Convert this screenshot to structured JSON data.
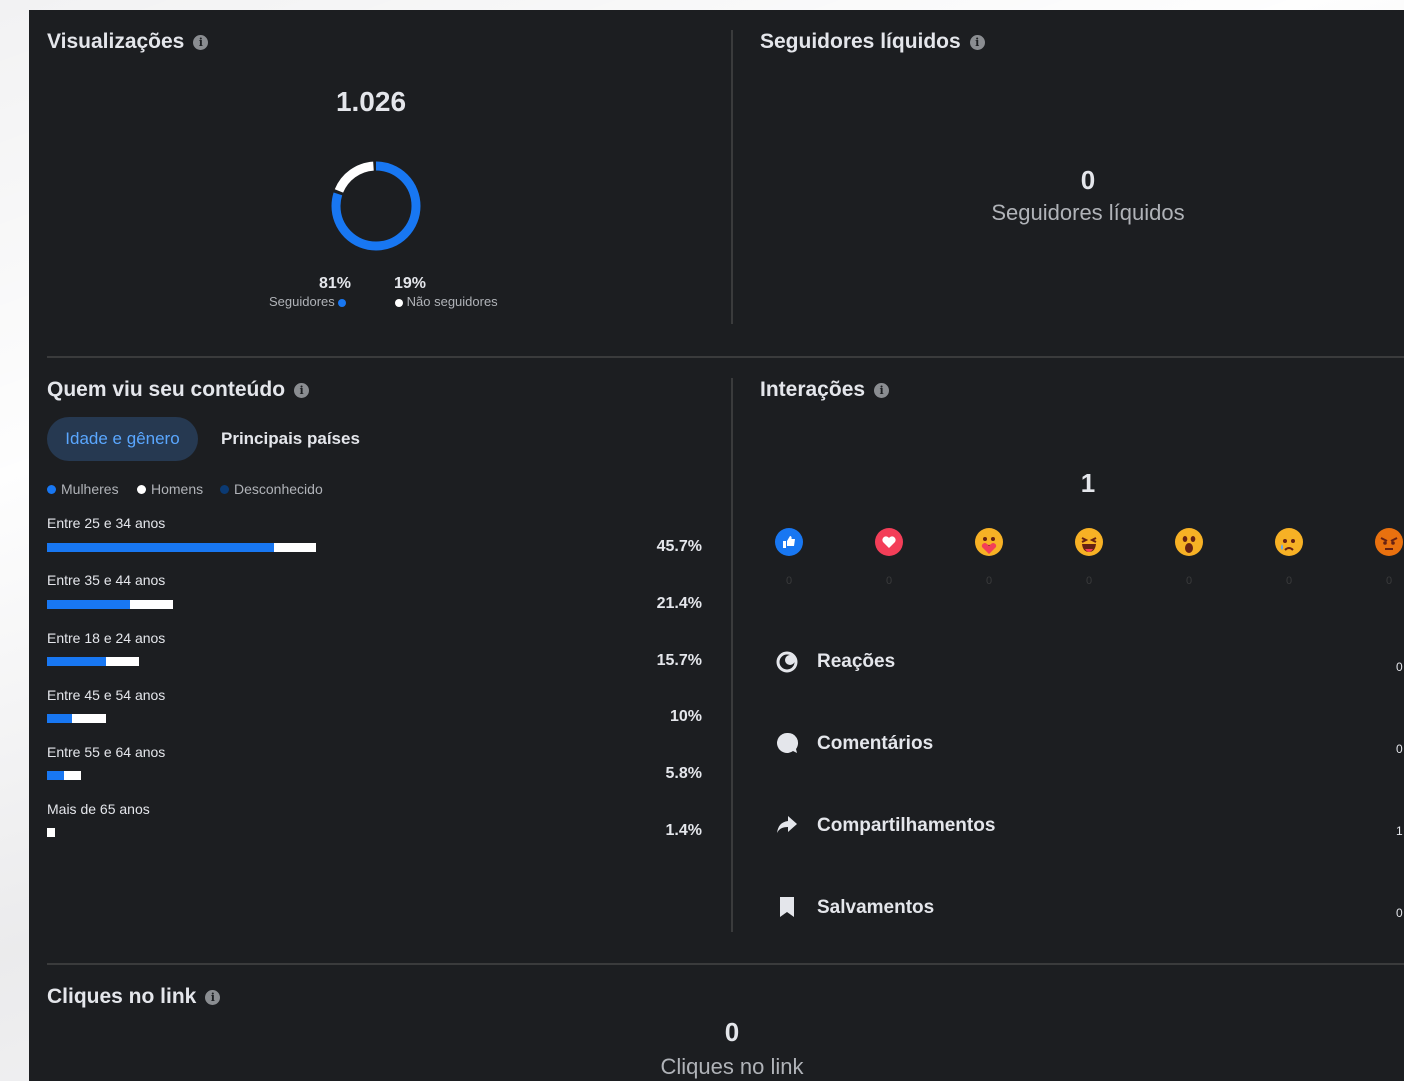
{
  "views": {
    "title": "Visualizações",
    "total": "1.026",
    "followers_pct": "81%",
    "followers_label": "Seguidores",
    "nonfollowers_pct": "19%",
    "nonfollowers_label": "Não seguidores",
    "followers_fraction": 0.81,
    "followers_color": "#1877f2",
    "nonfollowers_color": "#ffffff"
  },
  "net_followers": {
    "title": "Seguidores líquidos",
    "value": "0",
    "label": "Seguidores líquidos"
  },
  "audience": {
    "title": "Quem viu seu conteúdo",
    "tabs": [
      "Idade e gênero",
      "Principais países"
    ],
    "active_tab": "Idade e gênero",
    "legend": [
      {
        "label": "Mulheres",
        "color": "#1877f2"
      },
      {
        "label": "Homens",
        "color": "#ffffff"
      },
      {
        "label": "Desconhecido",
        "color": "#0b3a73"
      }
    ],
    "age_groups": [
      {
        "label": "Entre 25 e 34 anos",
        "pct": "45.7%",
        "total": 45.7,
        "women_share": 0.845
      },
      {
        "label": "Entre 35 e 44 anos",
        "pct": "21.4%",
        "total": 21.4,
        "women_share": 0.66
      },
      {
        "label": "Entre 18 e 24 anos",
        "pct": "15.7%",
        "total": 15.7,
        "women_share": 0.64
      },
      {
        "label": "Entre 45 e 54 anos",
        "pct": "10%",
        "total": 10,
        "women_share": 0.42
      },
      {
        "label": "Entre 55 e 64 anos",
        "pct": "5.8%",
        "total": 5.8,
        "women_share": 0.5
      },
      {
        "label": "Mais de 65 anos",
        "pct": "1.4%",
        "total": 1.4,
        "women_share": 0
      }
    ]
  },
  "interactions": {
    "title": "Interações",
    "total": "1",
    "reactions": [
      {
        "icon": "like-icon",
        "color": "#1877f2",
        "count": "0"
      },
      {
        "icon": "love-icon",
        "color": "#f33e58",
        "count": "0"
      },
      {
        "icon": "care-icon",
        "color": "#f7b125",
        "count": "0"
      },
      {
        "icon": "haha-icon",
        "color": "#f7b125",
        "count": "0"
      },
      {
        "icon": "wow-icon",
        "color": "#f7b125",
        "count": "0"
      },
      {
        "icon": "sad-icon",
        "color": "#f7b125",
        "count": "0"
      },
      {
        "icon": "angry-icon",
        "color": "#e9710f",
        "count": "0"
      }
    ],
    "rows": [
      {
        "icon": "reactions-icon",
        "label": "Reações",
        "value": "0"
      },
      {
        "icon": "comment-icon",
        "label": "Comentários",
        "value": "0"
      },
      {
        "icon": "share-icon",
        "label": "Compartilhamentos",
        "value": "1"
      },
      {
        "icon": "bookmark-icon",
        "label": "Salvamentos",
        "value": "0"
      }
    ]
  },
  "link_clicks": {
    "title": "Cliques no link",
    "value": "0",
    "label": "Cliques no link"
  }
}
